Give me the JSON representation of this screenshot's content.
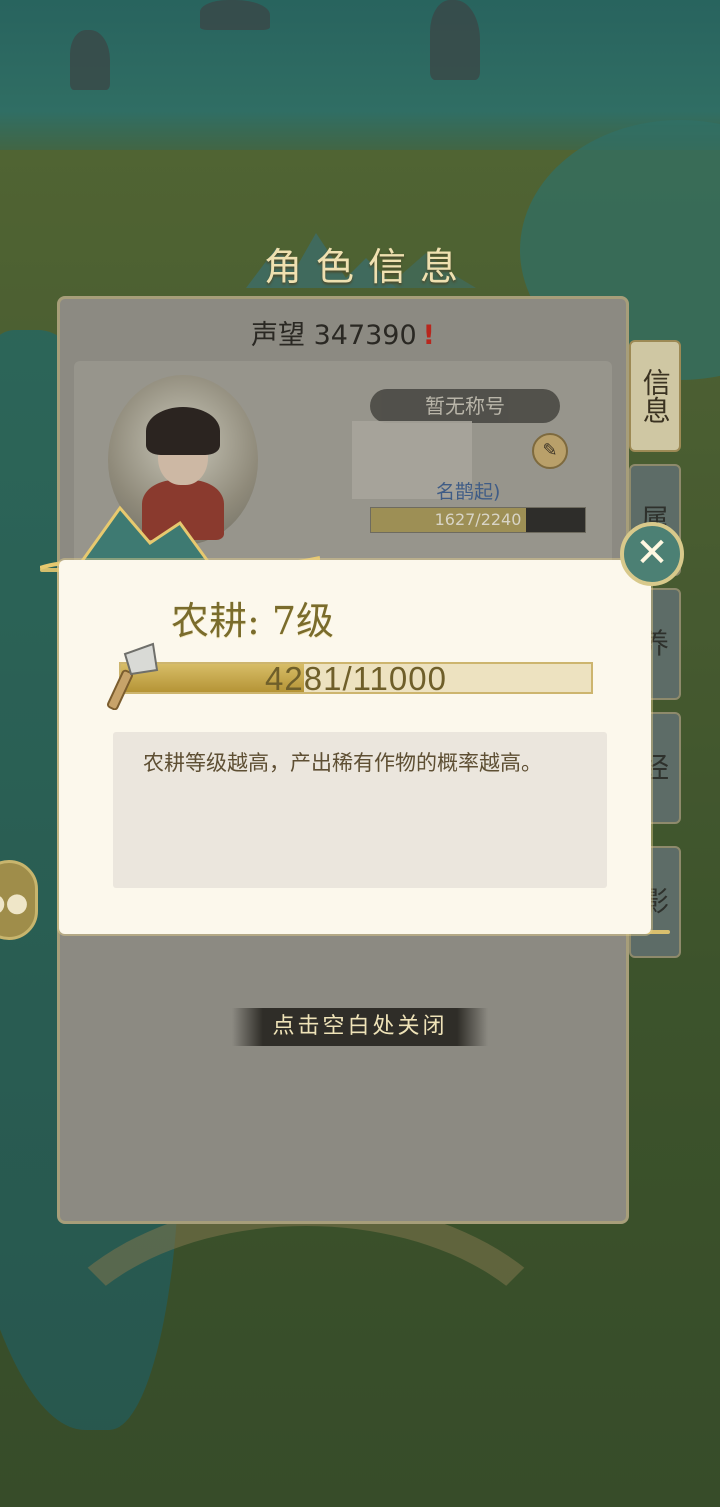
{
  "window": {
    "title": "角色信息"
  },
  "info_panel": {
    "reputation_label": "声望",
    "reputation_value": "347390",
    "reputation_alert": "!",
    "title_tag": "暂无称号",
    "subname": "名鹊起)",
    "exp_text": "1627/2240",
    "exp_fraction": 0.726
  },
  "side_tabs": [
    {
      "label": "信息",
      "active": true
    },
    {
      "label": "属"
    },
    {
      "label": "养"
    },
    {
      "label": "经"
    },
    {
      "label": "影"
    }
  ],
  "modal": {
    "skill_title": "农耕: 7级",
    "progress_text": "4281/11000",
    "progress_fraction": 0.389,
    "description": "农耕等级越高，产出稀有作物的概率越高。",
    "close_icon": "close-x-icon",
    "skill_icon": "hoe-icon"
  },
  "hint": {
    "text": "点击空白处关闭"
  },
  "chat": {
    "icon": "chat-bubble-icon"
  },
  "colors": {
    "modal_bg": "#fcf8ec",
    "gold": "#cdb56e",
    "title_text": "#7a6c2c",
    "close_bg": "#4c8074"
  }
}
